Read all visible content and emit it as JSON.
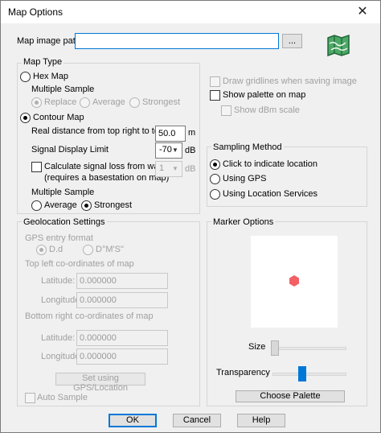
{
  "window": {
    "title": "Map Options",
    "close_glyph": "✕"
  },
  "map_image": {
    "label": "Map image path",
    "value": "",
    "browse_label": "..."
  },
  "map_type": {
    "group_label": "Map Type",
    "hex_map": {
      "label": "Hex Map",
      "selected": false
    },
    "hex_multiple_sample": {
      "label": "Multiple Sample",
      "options": [
        "Replace",
        "Average",
        "Strongest"
      ],
      "selected": "Replace"
    },
    "contour_map": {
      "label": "Contour Map",
      "selected": true
    },
    "real_distance": {
      "label": "Real distance from top right to top left",
      "value": "50.0",
      "unit": "m"
    },
    "signal_display_limit": {
      "label": "Signal Display Limit",
      "value": "-70",
      "unit": "dB"
    },
    "calc_signal_loss": {
      "label_line1": "Calculate signal loss from walls",
      "label_line2": "(requires a basestation on map)",
      "checked": false,
      "value": "1",
      "unit": "dB"
    },
    "contour_multiple_sample": {
      "label": "Multiple Sample",
      "options": [
        "Average",
        "Strongest"
      ],
      "selected": "Strongest"
    }
  },
  "display_options": {
    "draw_gridlines": {
      "label": "Draw gridlines when saving image",
      "checked": false
    },
    "show_palette": {
      "label": "Show palette on map",
      "checked": false
    },
    "show_dbm_scale": {
      "label": "Show dBm scale",
      "checked": false
    }
  },
  "sampling_method": {
    "group_label": "Sampling Method",
    "options": [
      "Click to indicate location",
      "Using GPS",
      "Using Location Services"
    ],
    "selected": "Click to indicate location"
  },
  "geolocation": {
    "group_label": "Geolocation Settings",
    "gps_entry_format": {
      "label": "GPS entry format",
      "options": [
        "D.d",
        "D°M'S\""
      ],
      "selected": "D.d"
    },
    "top_left": {
      "label": "Top left co-ordinates of map",
      "latitude_label": "Latitude:",
      "latitude": "0.000000",
      "longitude_label": "Longitude:",
      "longitude": "0.000000"
    },
    "bottom_right": {
      "label": "Bottom right  co-ordinates of map",
      "latitude_label": "Latitude:",
      "latitude": "0.000000",
      "longitude_label": "Longitude:",
      "longitude": "0.000000"
    },
    "set_gps_button": "Set using GPS/Location",
    "auto_sample": {
      "label": "Auto Sample",
      "checked": false
    }
  },
  "marker_options": {
    "group_label": "Marker Options",
    "size_label": "Size",
    "size_level": 0,
    "transparency_label": "Transparency",
    "transparency_level": 0.4,
    "marker_color": "#f26065",
    "choose_palette_label": "Choose Palette"
  },
  "footer": {
    "ok": "OK",
    "cancel": "Cancel",
    "help": "Help"
  },
  "colors": {
    "accent": "#0078d7",
    "map_icon": "#2f8a4a"
  }
}
